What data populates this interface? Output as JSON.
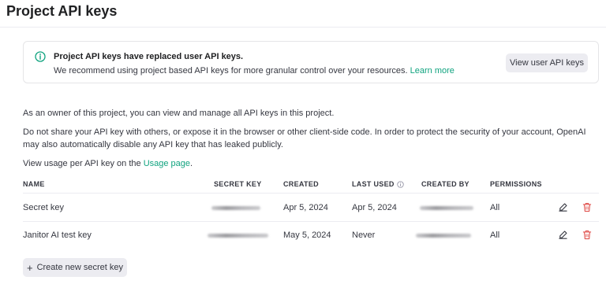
{
  "page": {
    "title": "Project API keys"
  },
  "notice": {
    "title": "Project API keys have replaced user API keys.",
    "body": "We recommend using project based API keys for more granular control over your resources.",
    "link": "Learn more",
    "button": "View user API keys"
  },
  "description": {
    "p1": "As an owner of this project, you can view and manage all API keys in this project.",
    "p2": "Do not share your API key with others, or expose it in the browser or other client-side code. In order to protect the security of your account, OpenAI may also automatically disable any API key that has leaked publicly.",
    "p3_prefix": "View usage per API key on the",
    "p3_link": "Usage page",
    "p3_suffix": "."
  },
  "table": {
    "headers": {
      "name": "NAME",
      "secret_key": "SECRET KEY",
      "created": "CREATED",
      "last_used": "LAST USED",
      "created_by": "CREATED BY",
      "permissions": "PERMISSIONS"
    },
    "rows": [
      {
        "name": "Secret key",
        "created": "Apr 5, 2024",
        "last_used": "Apr 5, 2024",
        "permissions": "All"
      },
      {
        "name": "Janitor AI test key",
        "created": "May 5, 2024",
        "last_used": "Never",
        "permissions": "All"
      }
    ]
  },
  "actions": {
    "create": "Create new secret key"
  },
  "colors": {
    "accent": "#10a37f",
    "danger": "#e0524e",
    "button_bg": "#ececf1"
  },
  "icons": {
    "notice": "info-circle-icon",
    "last_used_info": "info-icon",
    "edit": "pencil-icon",
    "delete": "trash-icon",
    "create": "plus-icon"
  }
}
